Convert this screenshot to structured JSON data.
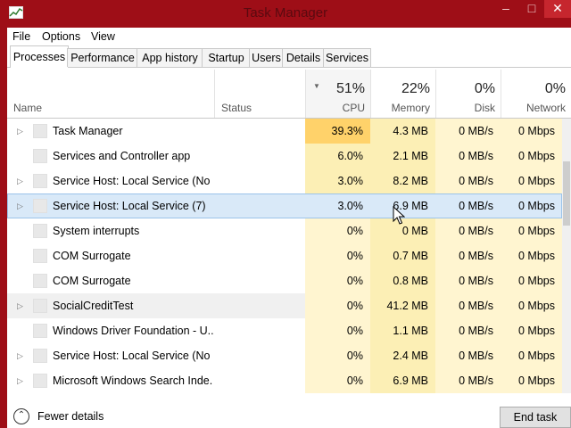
{
  "window": {
    "title": "Task Manager",
    "minimize_glyph": "–",
    "maximize_glyph": "□",
    "close_glyph": "✕"
  },
  "menu": [
    "File",
    "Options",
    "View"
  ],
  "tabs": [
    {
      "label": "Processes",
      "active": true
    },
    {
      "label": "Performance",
      "active": false
    },
    {
      "label": "App history",
      "active": false
    },
    {
      "label": "Startup",
      "active": false
    },
    {
      "label": "Users",
      "active": false
    },
    {
      "label": "Details",
      "active": false
    },
    {
      "label": "Services",
      "active": false
    }
  ],
  "columns": {
    "name": "Name",
    "status": "Status",
    "cpu": {
      "pct": "51%",
      "label": "CPU"
    },
    "memory": {
      "pct": "22%",
      "label": "Memory"
    },
    "disk": {
      "pct": "0%",
      "label": "Disk"
    },
    "network": {
      "pct": "0%",
      "label": "Network"
    }
  },
  "heat_colors": {
    "cpu_high": "#ffd26a",
    "medium": "#fcefb5",
    "light": "#fff5d0",
    "header_gray": "#f5f5f5"
  },
  "processes": [
    {
      "expandable": true,
      "name": "Task Manager",
      "status": "",
      "cpu": "39.3%",
      "memory": "4.3 MB",
      "disk": "0 MB/s",
      "network": "0 Mbps"
    },
    {
      "expandable": false,
      "name": "Services and Controller app",
      "status": "",
      "cpu": "6.0%",
      "memory": "2.1 MB",
      "disk": "0 MB/s",
      "network": "0 Mbps"
    },
    {
      "expandable": true,
      "name": "Service Host: Local Service (No ...",
      "status": "",
      "cpu": "3.0%",
      "memory": "8.2 MB",
      "disk": "0 MB/s",
      "network": "0 Mbps"
    },
    {
      "expandable": true,
      "name": "Service Host: Local Service (7)",
      "status": "",
      "cpu": "3.0%",
      "memory": "6.9 MB",
      "disk": "0 MB/s",
      "network": "0 Mbps",
      "selected": true
    },
    {
      "expandable": false,
      "name": "System interrupts",
      "status": "",
      "cpu": "0%",
      "memory": "0 MB",
      "disk": "0 MB/s",
      "network": "0 Mbps"
    },
    {
      "expandable": false,
      "name": "COM Surrogate",
      "status": "",
      "cpu": "0%",
      "memory": "0.7 MB",
      "disk": "0 MB/s",
      "network": "0 Mbps"
    },
    {
      "expandable": false,
      "name": "COM Surrogate",
      "status": "",
      "cpu": "0%",
      "memory": "0.8 MB",
      "disk": "0 MB/s",
      "network": "0 Mbps"
    },
    {
      "expandable": true,
      "name": "SocialCreditTest",
      "status": "",
      "cpu": "0%",
      "memory": "41.2 MB",
      "disk": "0 MB/s",
      "network": "0 Mbps",
      "hover": true
    },
    {
      "expandable": false,
      "name": "Windows Driver Foundation - U...",
      "status": "",
      "cpu": "0%",
      "memory": "1.1 MB",
      "disk": "0 MB/s",
      "network": "0 Mbps"
    },
    {
      "expandable": true,
      "name": "Service Host: Local Service (No I...",
      "status": "",
      "cpu": "0%",
      "memory": "2.4 MB",
      "disk": "0 MB/s",
      "network": "0 Mbps"
    },
    {
      "expandable": true,
      "name": "Microsoft Windows Search Inde...",
      "status": "",
      "cpu": "0%",
      "memory": "6.9 MB",
      "disk": "0 MB/s",
      "network": "0 Mbps"
    }
  ],
  "footer": {
    "fewer_details": "Fewer details",
    "end_task": "End task"
  }
}
